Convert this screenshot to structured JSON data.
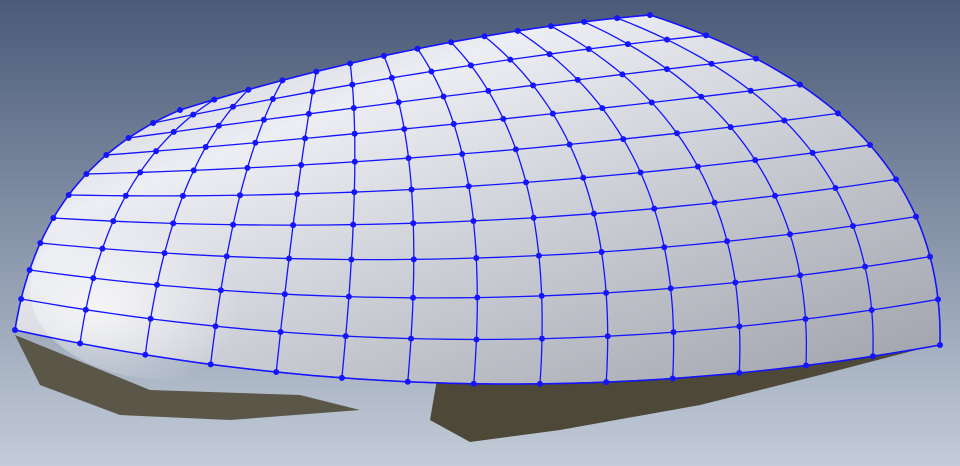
{
  "colors": {
    "background_top": "#4a5a78",
    "background_bottom": "#c3ccd8",
    "surface_light": "#f2f3f7",
    "surface_shade": "#9a9ca6",
    "underside": "#4d4838",
    "mesh": "#1414ff"
  },
  "mesh": {
    "u_lines": 14,
    "v_lines": 10
  }
}
